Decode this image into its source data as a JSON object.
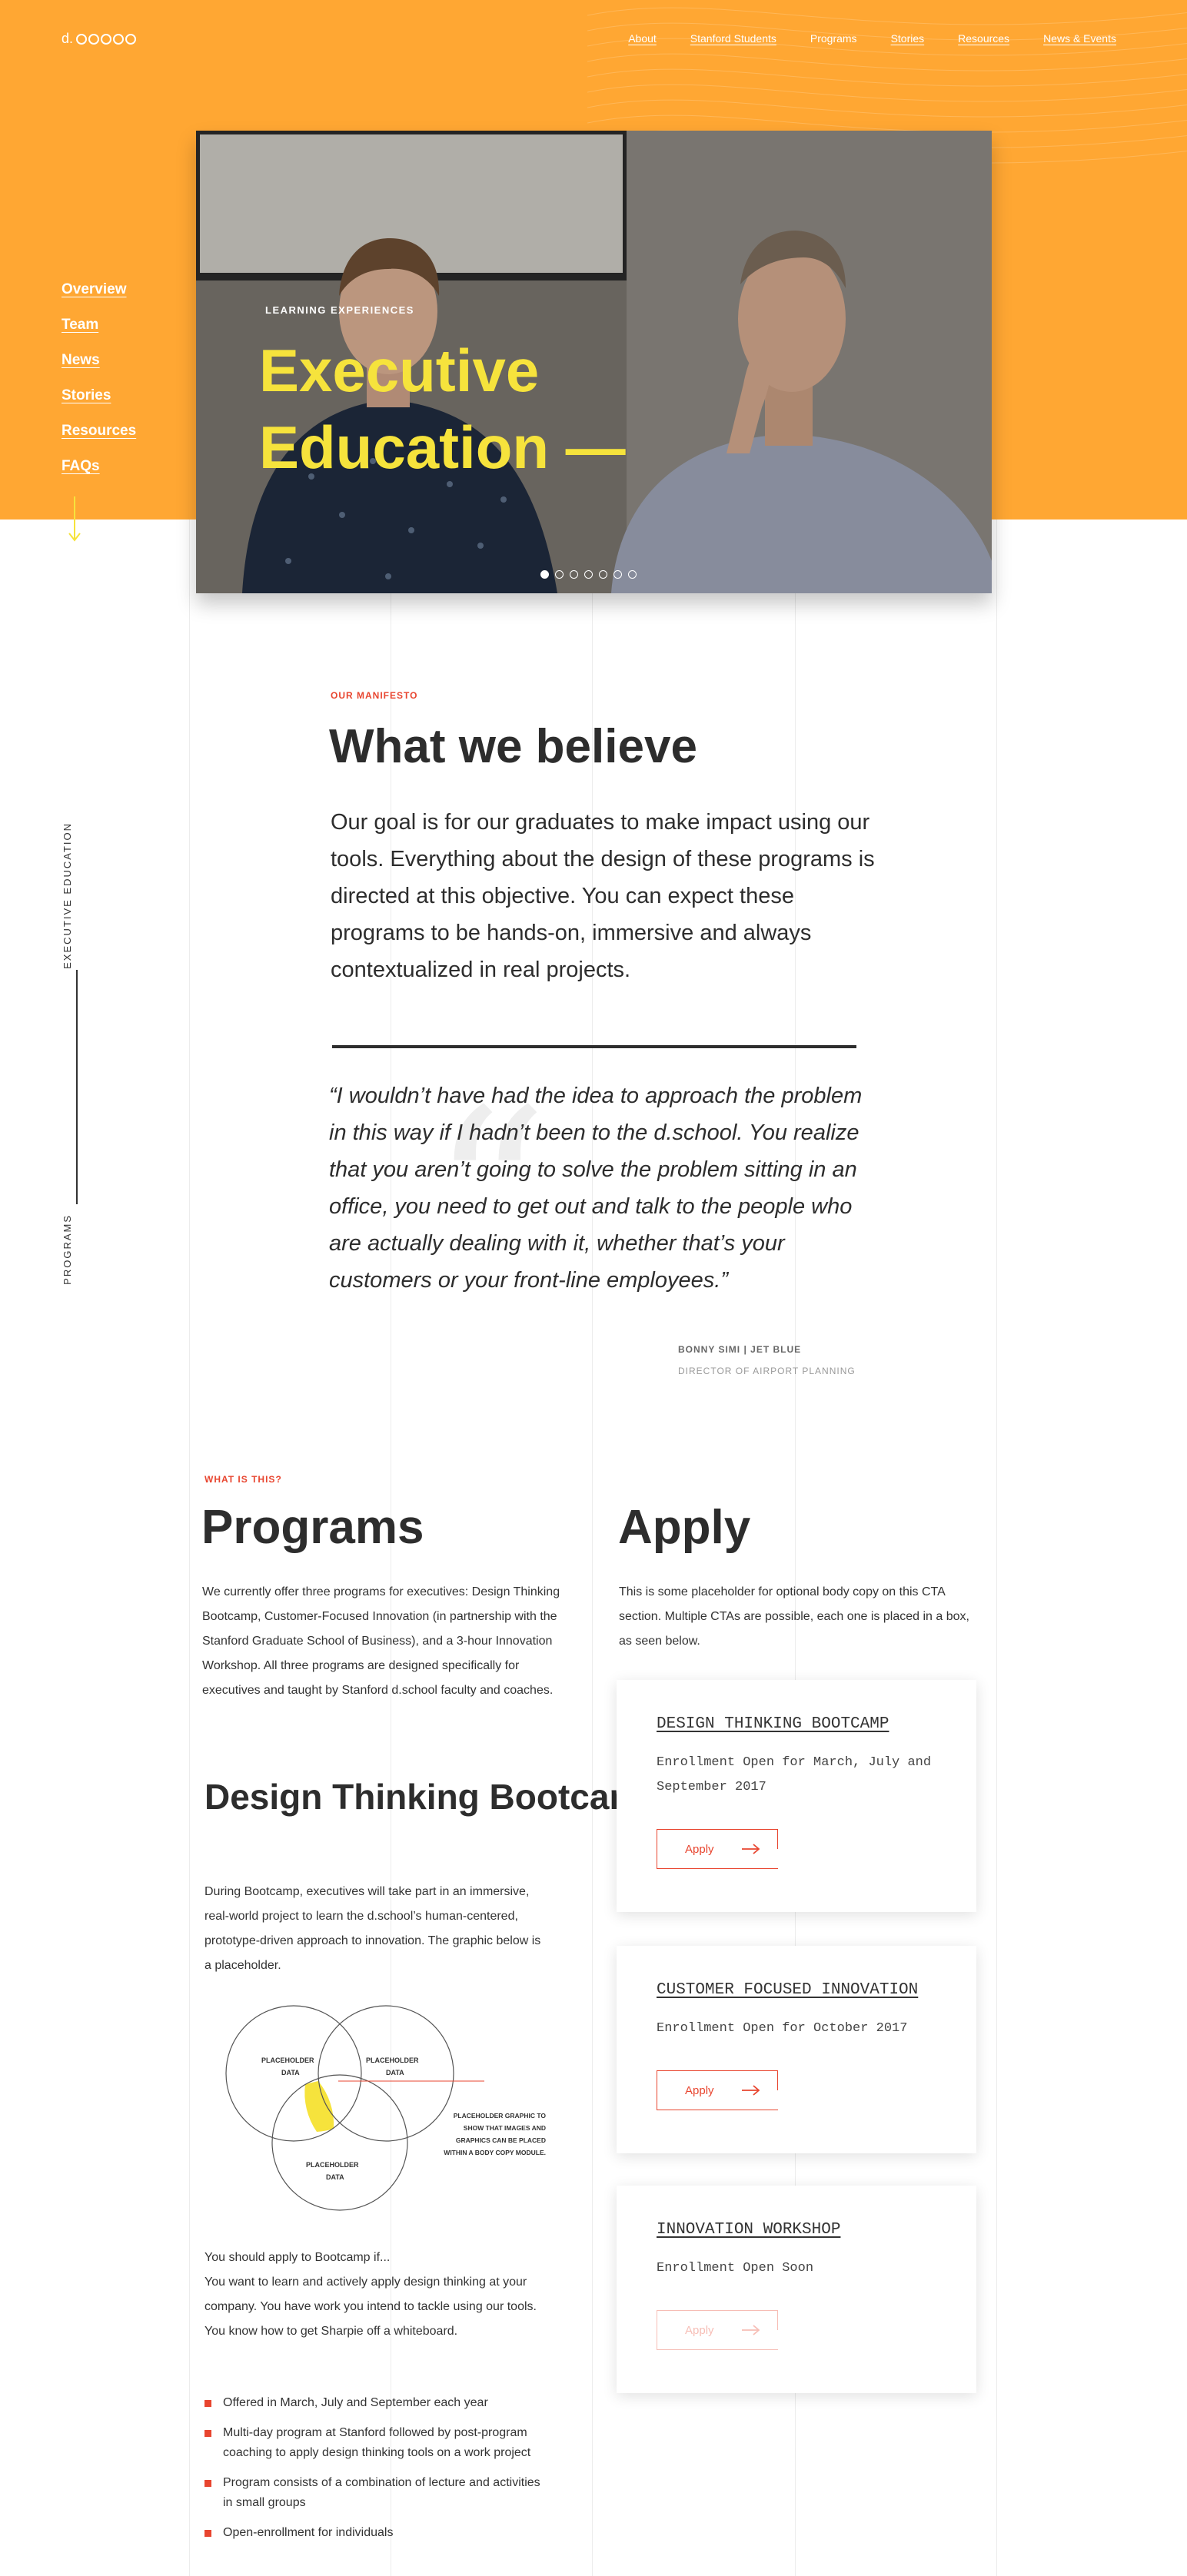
{
  "header": {
    "logo": "d.",
    "nav": [
      {
        "label": "About"
      },
      {
        "label": "Stanford Students"
      },
      {
        "label": "Programs"
      },
      {
        "label": "Stories"
      },
      {
        "label": "Resources"
      },
      {
        "label": "News & Events"
      }
    ]
  },
  "sidebar": {
    "items": [
      {
        "label": "Overview"
      },
      {
        "label": "Team"
      },
      {
        "label": "News"
      },
      {
        "label": "Stories"
      },
      {
        "label": "Resources"
      },
      {
        "label": "FAQs"
      }
    ],
    "vertical_top": "EXECUTIVE EDUCATION",
    "vertical_bottom": "PROGRAMS"
  },
  "hero": {
    "eyebrow": "LEARNING EXPERIENCES",
    "title_line1": "Executive",
    "title_line2": "Education —",
    "slide_count": 7,
    "active_slide": 1
  },
  "manifesto": {
    "label": "OUR MANIFESTO",
    "title": "What we believe",
    "body": "Our goal is for our graduates to make impact using our tools. Everything about the design of these programs is directed at this objective. You can expect these programs to be hands-on, immersive and always contextualized in real projects.",
    "quote": "“I wouldn’t have had the idea to approach the problem in this way if I hadn’t been to the d.school. You realize that you aren’t going to solve the problem sitting in an office, you need to get out and talk to the people who are actually dealing with it, whether that’s your customers or your front-line employees.”",
    "quote_author": "BONNY SIMI | JET BLUE",
    "quote_role": "DIRECTOR OF AIRPORT PLANNING"
  },
  "programs": {
    "label": "WHAT IS THIS?",
    "title": "Programs",
    "body": "We currently offer three programs for executives: Design Thinking Bootcamp, Customer-Focused Innovation (in partnership with the  Stanford Graduate School of Business), and a 3-hour Innovation Workshop. All three programs are designed specifically for executives and taught by Stanford d.school faculty and coaches.",
    "bootcamp_title": "Design Thinking Bootcamp",
    "bootcamp_body": "During Bootcamp, executives will take part in an immersive, real-world project to learn the d.school’s human-centered, prototype-driven approach to innovation. The graphic below is a placeholder.",
    "venn": {
      "circle1": "PLACEHOLDER DATA",
      "circle2": "PLACEHOLDER DATA",
      "circle3": "PLACEHOLDER DATA",
      "note": "PLACEHOLDER GRAPHIC TO SHOW THAT IMAGES AND GRAPHICS CAN BE PLACED WITHIN A BODY COPY MODULE."
    },
    "apply_if_heading": "You should apply to Bootcamp if...",
    "apply_if_body": "You want to learn and actively apply design thinking at your company. You have work you intend to tackle using our tools. You know how to get Sharpie off a whiteboard.",
    "bullets": [
      "Offered in March, July and September each year",
      "Multi-day program at Stanford followed by post-program coaching to apply design thinking tools on a work project",
      "Program consists of a combination of lecture and activities in small groups",
      "Open-enrollment for individuals"
    ]
  },
  "apply": {
    "title": "Apply",
    "body": "This is some placeholder for optional body copy on this CTA section. Multiple CTAs are possible, each one is placed in a box, as seen below.",
    "cards": [
      {
        "title": "DESIGN THINKING BOOTCAMP",
        "body": "Enrollment Open for March, July and September 2017",
        "button": "Apply"
      },
      {
        "title": "CUSTOMER FOCUSED INNOVATION",
        "body": "Enrollment Open for October 2017",
        "button": "Apply"
      },
      {
        "title": "INNOVATION WORKSHOP",
        "body": "Enrollment Open Soon",
        "button": "Apply"
      }
    ]
  },
  "colors": {
    "brand_orange": "#ffa733",
    "accent_red": "#e8452f",
    "highlight_yellow": "#f6e33c"
  }
}
